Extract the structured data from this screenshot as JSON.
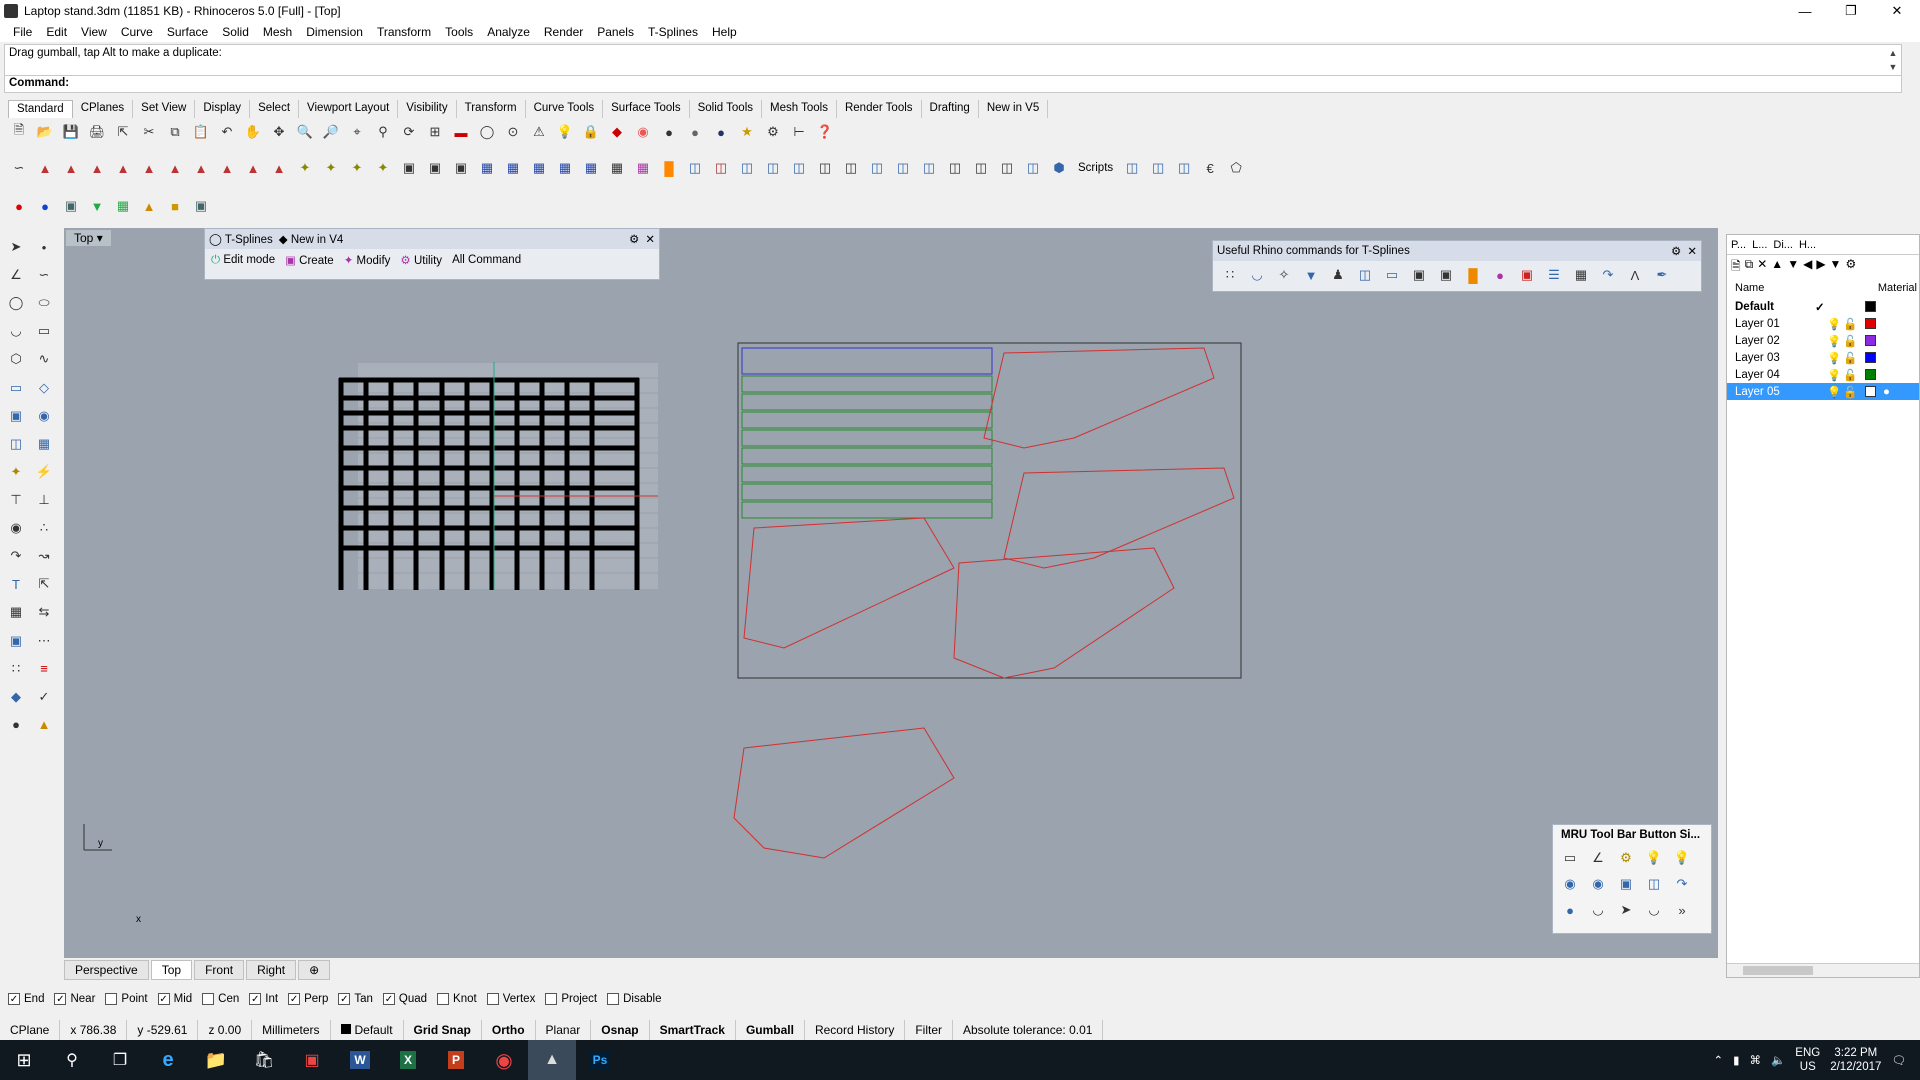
{
  "window": {
    "title": "Laptop stand.3dm (11851 KB) - Rhinoceros 5.0 [Full] - [Top]"
  },
  "menu": [
    "File",
    "Edit",
    "View",
    "Curve",
    "Surface",
    "Solid",
    "Mesh",
    "Dimension",
    "Transform",
    "Tools",
    "Analyze",
    "Render",
    "Panels",
    "T-Splines",
    "Help"
  ],
  "command": {
    "history": "Drag gumball, tap Alt to make a duplicate:",
    "prompt": "Command:"
  },
  "toolbar_tabs": [
    "Standard",
    "CPlanes",
    "Set View",
    "Display",
    "Select",
    "Viewport Layout",
    "Visibility",
    "Transform",
    "Curve Tools",
    "Surface Tools",
    "Solid Tools",
    "Mesh Tools",
    "Render Tools",
    "Drafting",
    "New in V5"
  ],
  "toolbar_tab_active": "Standard",
  "toolbar_row2_label": "Scripts",
  "viewport": {
    "name": "Top",
    "bg": "#9aa3ae"
  },
  "tsplines_panel": {
    "tabs": [
      "T-Splines",
      "New in V4"
    ],
    "buttons": [
      "Edit mode",
      "Create",
      "Modify",
      "Utility",
      "All Command"
    ]
  },
  "useful_panel": {
    "title": "Useful Rhino commands for T-Splines"
  },
  "mru_panel": {
    "title": "MRU Tool Bar Button Si...",
    "more": "»"
  },
  "viewport_tabs": [
    "Perspective",
    "Top",
    "Front",
    "Right"
  ],
  "viewport_tab_active": "Top",
  "osnaps": [
    {
      "label": "End",
      "checked": true
    },
    {
      "label": "Near",
      "checked": true
    },
    {
      "label": "Point",
      "checked": false
    },
    {
      "label": "Mid",
      "checked": true
    },
    {
      "label": "Cen",
      "checked": false
    },
    {
      "label": "Int",
      "checked": true
    },
    {
      "label": "Perp",
      "checked": true
    },
    {
      "label": "Tan",
      "checked": true
    },
    {
      "label": "Quad",
      "checked": true
    },
    {
      "label": "Knot",
      "checked": false
    },
    {
      "label": "Vertex",
      "checked": false
    },
    {
      "label": "Project",
      "checked": false
    },
    {
      "label": "Disable",
      "checked": false
    }
  ],
  "status": {
    "cplane": "CPlane",
    "x": "x 786.38",
    "y": "y -529.61",
    "z": "z 0.00",
    "units": "Millimeters",
    "layer": "Default",
    "toggles": [
      "Grid Snap",
      "Ortho",
      "Planar",
      "Osnap",
      "SmartTrack",
      "Gumball",
      "Record History",
      "Filter"
    ],
    "tolerance": "Absolute tolerance: 0.01"
  },
  "layers_panel": {
    "tabs": [
      "P...",
      "L...",
      "Di...",
      "H..."
    ],
    "col_name": "Name",
    "col_material": "Material",
    "layers": [
      {
        "name": "Default",
        "color": "#000000",
        "current": true
      },
      {
        "name": "Layer 01",
        "color": "#e00000"
      },
      {
        "name": "Layer 02",
        "color": "#8a2be2"
      },
      {
        "name": "Layer 03",
        "color": "#0000ff"
      },
      {
        "name": "Layer 04",
        "color": "#008000"
      },
      {
        "name": "Layer 05",
        "color": "#ffffff",
        "selected": true
      }
    ]
  },
  "tray": {
    "lang": "ENG",
    "region": "US",
    "time": "3:22 PM",
    "date": "2/12/2017"
  },
  "axis": {
    "x": "x",
    "y": "y"
  }
}
